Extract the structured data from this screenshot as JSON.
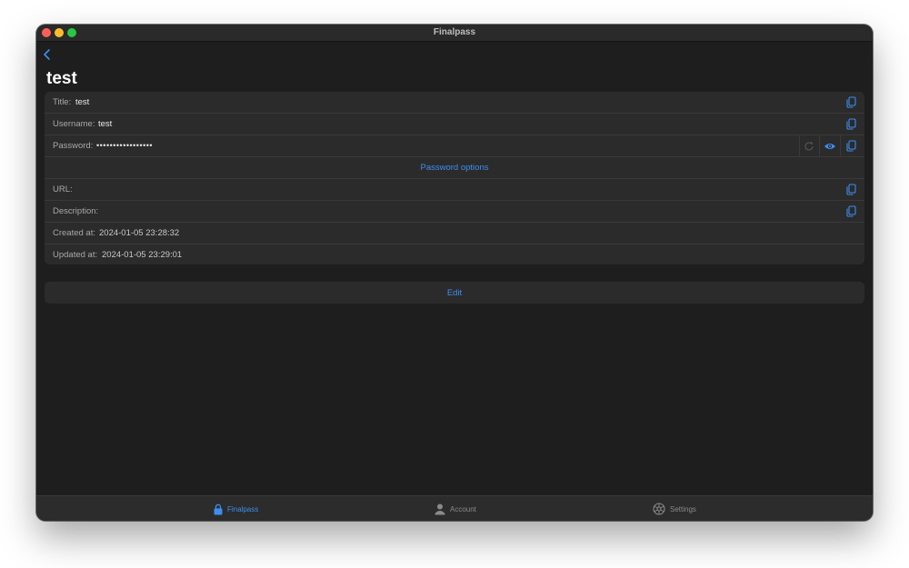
{
  "window": {
    "title": "Finalpass"
  },
  "page": {
    "title": "test"
  },
  "fields": {
    "title": {
      "label": "Title:",
      "value": "test"
    },
    "username": {
      "label": "Username:",
      "value": "test"
    },
    "password": {
      "label": "Password:",
      "value": "•••••••••••••••••"
    },
    "password_options": "Password options",
    "url": {
      "label": "URL:",
      "value": ""
    },
    "description": {
      "label": "Description:",
      "value": ""
    },
    "created": {
      "label": "Created at:",
      "value": "2024-01-05 23:28:32"
    },
    "updated": {
      "label": "Updated at:",
      "value": "2024-01-05 23:29:01"
    }
  },
  "edit_label": "Edit",
  "tabs": [
    {
      "label": "Finalpass",
      "icon": "lock-icon",
      "active": true
    },
    {
      "label": "Account",
      "icon": "person-icon",
      "active": false
    },
    {
      "label": "Settings",
      "icon": "gear-icon",
      "active": false
    }
  ],
  "colors": {
    "accent": "#3d8ef0",
    "background": "#1e1e1e",
    "card": "#2b2b2b"
  }
}
